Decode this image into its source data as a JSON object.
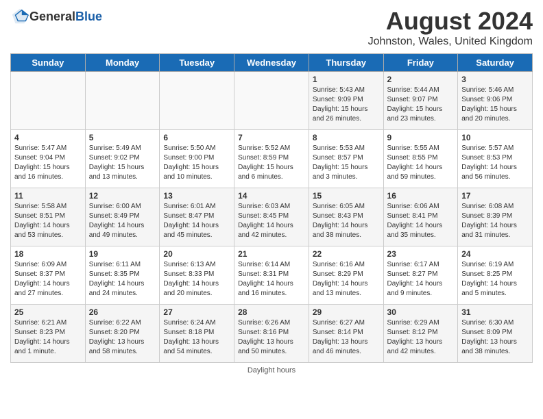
{
  "header": {
    "logo_general": "General",
    "logo_blue": "Blue",
    "title": "August 2024",
    "subtitle": "Johnston, Wales, United Kingdom"
  },
  "days_of_week": [
    "Sunday",
    "Monday",
    "Tuesday",
    "Wednesday",
    "Thursday",
    "Friday",
    "Saturday"
  ],
  "weeks": [
    [
      {
        "day": "",
        "info": ""
      },
      {
        "day": "",
        "info": ""
      },
      {
        "day": "",
        "info": ""
      },
      {
        "day": "",
        "info": ""
      },
      {
        "day": "1",
        "info": "Sunrise: 5:43 AM\nSunset: 9:09 PM\nDaylight: 15 hours and 26 minutes."
      },
      {
        "day": "2",
        "info": "Sunrise: 5:44 AM\nSunset: 9:07 PM\nDaylight: 15 hours and 23 minutes."
      },
      {
        "day": "3",
        "info": "Sunrise: 5:46 AM\nSunset: 9:06 PM\nDaylight: 15 hours and 20 minutes."
      }
    ],
    [
      {
        "day": "4",
        "info": "Sunrise: 5:47 AM\nSunset: 9:04 PM\nDaylight: 15 hours and 16 minutes."
      },
      {
        "day": "5",
        "info": "Sunrise: 5:49 AM\nSunset: 9:02 PM\nDaylight: 15 hours and 13 minutes."
      },
      {
        "day": "6",
        "info": "Sunrise: 5:50 AM\nSunset: 9:00 PM\nDaylight: 15 hours and 10 minutes."
      },
      {
        "day": "7",
        "info": "Sunrise: 5:52 AM\nSunset: 8:59 PM\nDaylight: 15 hours and 6 minutes."
      },
      {
        "day": "8",
        "info": "Sunrise: 5:53 AM\nSunset: 8:57 PM\nDaylight: 15 hours and 3 minutes."
      },
      {
        "day": "9",
        "info": "Sunrise: 5:55 AM\nSunset: 8:55 PM\nDaylight: 14 hours and 59 minutes."
      },
      {
        "day": "10",
        "info": "Sunrise: 5:57 AM\nSunset: 8:53 PM\nDaylight: 14 hours and 56 minutes."
      }
    ],
    [
      {
        "day": "11",
        "info": "Sunrise: 5:58 AM\nSunset: 8:51 PM\nDaylight: 14 hours and 53 minutes."
      },
      {
        "day": "12",
        "info": "Sunrise: 6:00 AM\nSunset: 8:49 PM\nDaylight: 14 hours and 49 minutes."
      },
      {
        "day": "13",
        "info": "Sunrise: 6:01 AM\nSunset: 8:47 PM\nDaylight: 14 hours and 45 minutes."
      },
      {
        "day": "14",
        "info": "Sunrise: 6:03 AM\nSunset: 8:45 PM\nDaylight: 14 hours and 42 minutes."
      },
      {
        "day": "15",
        "info": "Sunrise: 6:05 AM\nSunset: 8:43 PM\nDaylight: 14 hours and 38 minutes."
      },
      {
        "day": "16",
        "info": "Sunrise: 6:06 AM\nSunset: 8:41 PM\nDaylight: 14 hours and 35 minutes."
      },
      {
        "day": "17",
        "info": "Sunrise: 6:08 AM\nSunset: 8:39 PM\nDaylight: 14 hours and 31 minutes."
      }
    ],
    [
      {
        "day": "18",
        "info": "Sunrise: 6:09 AM\nSunset: 8:37 PM\nDaylight: 14 hours and 27 minutes."
      },
      {
        "day": "19",
        "info": "Sunrise: 6:11 AM\nSunset: 8:35 PM\nDaylight: 14 hours and 24 minutes."
      },
      {
        "day": "20",
        "info": "Sunrise: 6:13 AM\nSunset: 8:33 PM\nDaylight: 14 hours and 20 minutes."
      },
      {
        "day": "21",
        "info": "Sunrise: 6:14 AM\nSunset: 8:31 PM\nDaylight: 14 hours and 16 minutes."
      },
      {
        "day": "22",
        "info": "Sunrise: 6:16 AM\nSunset: 8:29 PM\nDaylight: 14 hours and 13 minutes."
      },
      {
        "day": "23",
        "info": "Sunrise: 6:17 AM\nSunset: 8:27 PM\nDaylight: 14 hours and 9 minutes."
      },
      {
        "day": "24",
        "info": "Sunrise: 6:19 AM\nSunset: 8:25 PM\nDaylight: 14 hours and 5 minutes."
      }
    ],
    [
      {
        "day": "25",
        "info": "Sunrise: 6:21 AM\nSunset: 8:23 PM\nDaylight: 14 hours and 1 minute."
      },
      {
        "day": "26",
        "info": "Sunrise: 6:22 AM\nSunset: 8:20 PM\nDaylight: 13 hours and 58 minutes."
      },
      {
        "day": "27",
        "info": "Sunrise: 6:24 AM\nSunset: 8:18 PM\nDaylight: 13 hours and 54 minutes."
      },
      {
        "day": "28",
        "info": "Sunrise: 6:26 AM\nSunset: 8:16 PM\nDaylight: 13 hours and 50 minutes."
      },
      {
        "day": "29",
        "info": "Sunrise: 6:27 AM\nSunset: 8:14 PM\nDaylight: 13 hours and 46 minutes."
      },
      {
        "day": "30",
        "info": "Sunrise: 6:29 AM\nSunset: 8:12 PM\nDaylight: 13 hours and 42 minutes."
      },
      {
        "day": "31",
        "info": "Sunrise: 6:30 AM\nSunset: 8:09 PM\nDaylight: 13 hours and 38 minutes."
      }
    ]
  ],
  "footer": "Daylight hours"
}
